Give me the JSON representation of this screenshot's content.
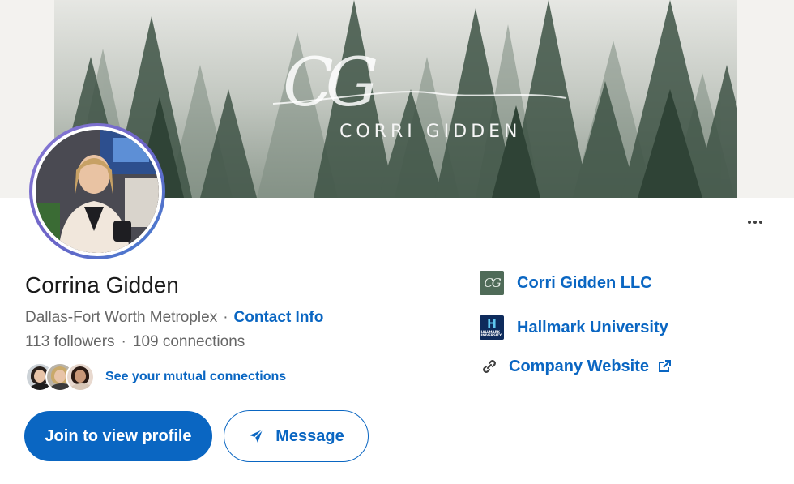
{
  "banner": {
    "monogram": "CG",
    "brand_name": "CORRI GIDDEN"
  },
  "profile": {
    "name": "Corrina Gidden",
    "location": "Dallas-Fort Worth Metroplex",
    "contact_label": "Contact Info",
    "followers": "113 followers",
    "connections": "109 connections",
    "mutual_label": "See your mutual connections"
  },
  "actions": {
    "join_label": "Join to view profile",
    "message_label": "Message"
  },
  "sidebar": {
    "company": {
      "name": "Corri Gidden LLC",
      "logo_text": "CG"
    },
    "education": {
      "name": "Hallmark University",
      "logo_text": "H",
      "logo_subtext": "HALLMARK UNIVERSITY"
    },
    "website": {
      "label": "Company Website"
    }
  },
  "icons": {
    "more": "more-horizontal-icon",
    "send": "paper-plane-icon",
    "link": "chain-link-icon",
    "external": "external-link-icon"
  },
  "colors": {
    "accent": "#0a66c2",
    "text_secondary": "#666666",
    "page_bg": "#f3f2ef"
  }
}
